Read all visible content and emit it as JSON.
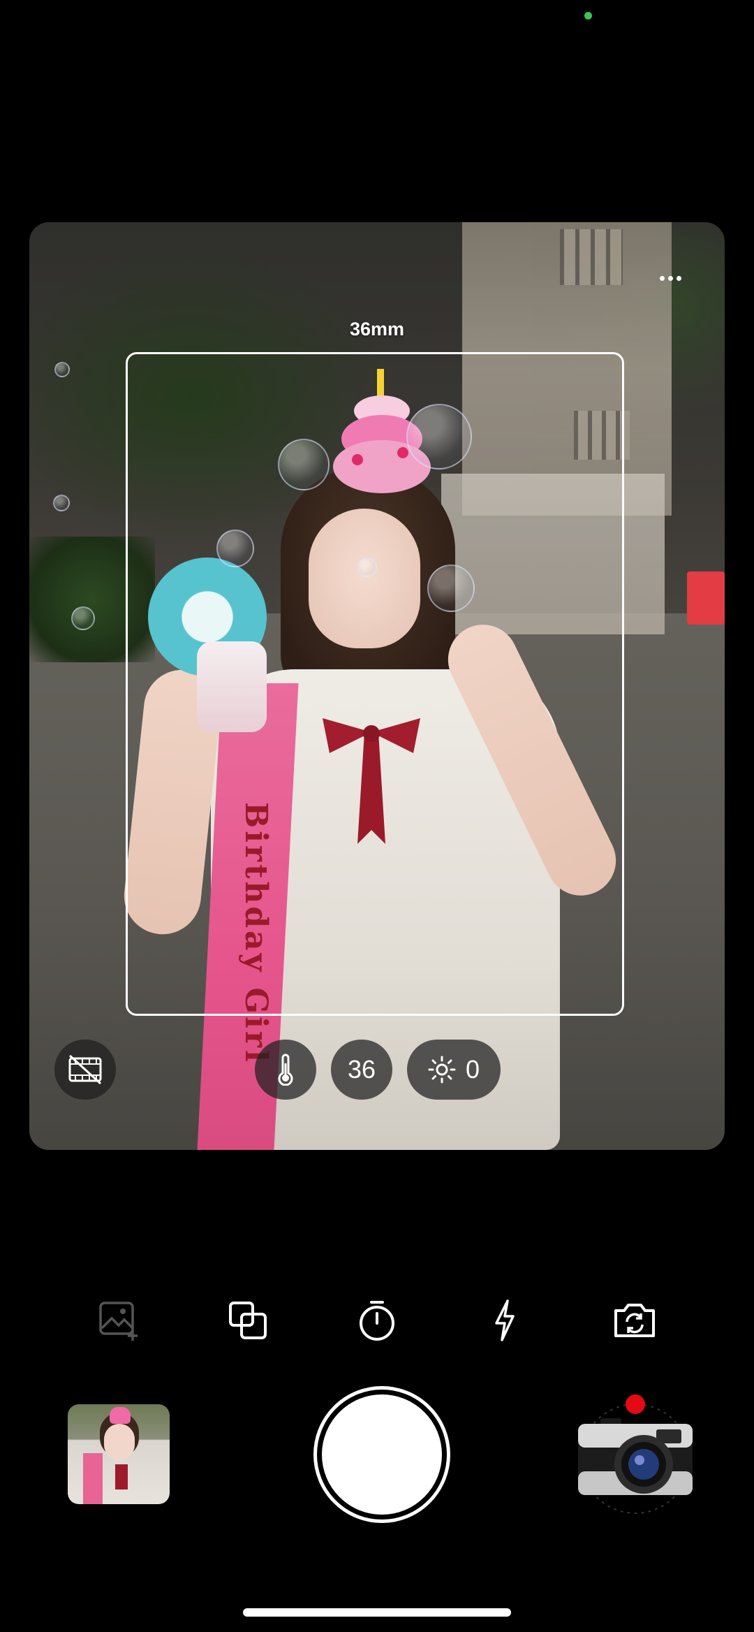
{
  "status_bar": {
    "privacy_indicator_color": "#35c759"
  },
  "viewfinder": {
    "focal_length_label": "36mm",
    "more_icon": "more-horizontal-icon",
    "subject_sash_text": "Birthday Girl",
    "controls": {
      "video_off_icon": "video-off-icon",
      "temperature_icon": "thermometer-icon",
      "focal_value": "36",
      "exposure_icon": "sun-icon",
      "exposure_value": "0"
    }
  },
  "toolbar": {
    "items": [
      {
        "name": "import-photo",
        "icon": "image-plus-icon",
        "enabled": false
      },
      {
        "name": "multiple-exposure",
        "icon": "layers-icon",
        "enabled": true
      },
      {
        "name": "timer",
        "icon": "timer-icon",
        "enabled": true
      },
      {
        "name": "flash",
        "icon": "flash-icon",
        "enabled": true
      },
      {
        "name": "switch-camera",
        "icon": "camera-flip-icon",
        "enabled": true
      }
    ]
  },
  "bottom": {
    "gallery_icon": "gallery-thumbnail",
    "shutter_icon": "shutter-button",
    "camera_model_icon": "retro-camera-icon",
    "indicator_color": "#e50914"
  }
}
